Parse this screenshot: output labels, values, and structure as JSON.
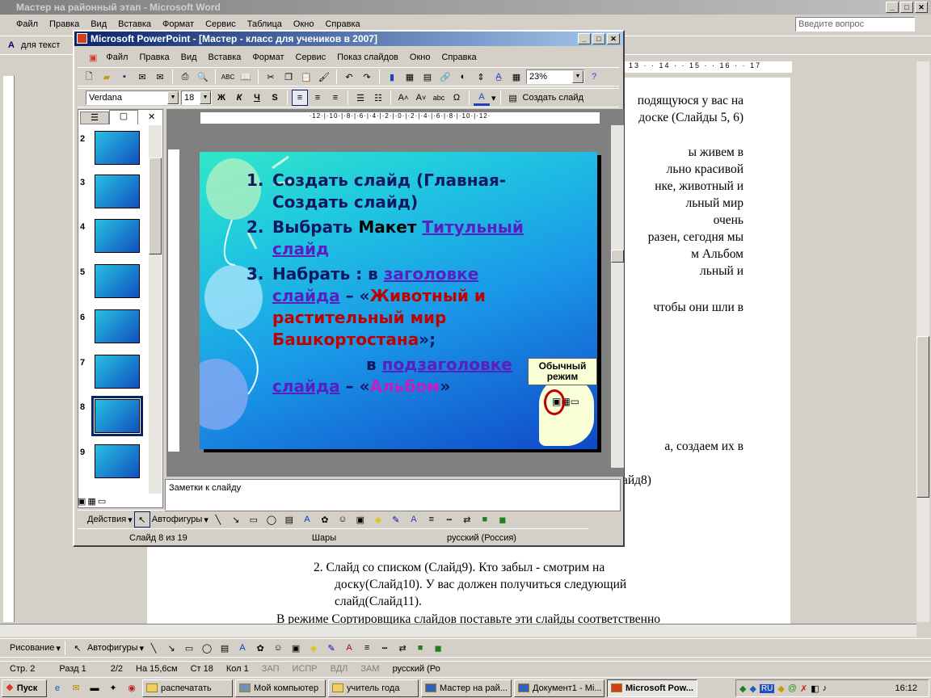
{
  "word": {
    "title": "Мастер на районный этап - Microsoft Word",
    "help_placeholder": "Введите вопрос",
    "style_box": "для текст",
    "ruler_nums": [
      "13",
      "14",
      "15",
      "16",
      "17"
    ],
    "lines": [
      "подящуюся у вас на",
      "доске (Слайды 5, 6)",
      "ы живем в",
      "льно красивой",
      "нке, животный и",
      "льный мир",
      "очень",
      "разен, сегодня мы",
      "м Альбом",
      "льный и",
      "чтобы они шли в",
      "а, создаем их в",
      "айд8)"
    ],
    "para2": [
      "2.  Слайд со списком (Слайд9). Кто забыл - смотрим на",
      "доску(Слайд10). У вас должен получиться следующий",
      "слайд(Слайд11)."
    ],
    "last_line": "В режиме Сортировщика слайдов поставьте эти слайды соответственно",
    "draw_label": "Рисование",
    "autoshapes": "Автофигуры",
    "status": {
      "page": "Стр. 2",
      "section": "Разд 1",
      "pages": "2/2",
      "at": "На 15,6см",
      "line": "Ст 18",
      "col": "Кол 1",
      "rec": "ЗАП",
      "trk": "ИСПР",
      "ext": "ВДЛ",
      "ovr": "ЗАМ",
      "lang": "русский (Ро"
    }
  },
  "ppt": {
    "title": "Microsoft PowerPoint - [Мастер - класс для учеников в 2007]",
    "menu": [
      "Файл",
      "Правка",
      "Вид",
      "Вставка",
      "Формат",
      "Сервис",
      "Показ слайдов",
      "Окно",
      "Справка"
    ],
    "zoom": "23%",
    "font": "Verdana",
    "size": "18",
    "fmt": [
      "Ж",
      "К",
      "Ч",
      "S"
    ],
    "new_slide": "Создать слайд",
    "ruler": "·12·|·10·|·8·|·6·|·4·|·2·|·0·|·2·|·4·|·6·|·8·|·10·|·12·",
    "thumb_nums": [
      "2",
      "3",
      "4",
      "5",
      "6",
      "7",
      "8",
      "9"
    ],
    "slide": {
      "i1a": "Создать слайд (Главная-",
      "i1b": "Создать слайд)",
      "i2a": "Выбрать ",
      "i2b": "Макет ",
      "i2c": "Титульный слайд",
      "i3a": "Набрать : в ",
      "i3b": "заголовке слайда",
      "i3c": " – «",
      "i3d": "Животный и растительный мир Башкортостана",
      "i3e": "»;",
      "p4a": "в ",
      "p4b": "подзаголовке",
      "p4c": "слайда",
      "p4d": " – «",
      "p4e": "Альбом",
      "p4f": "»",
      "callout": "Обычный режим"
    },
    "notes": "Заметки к слайду",
    "actions": "Действия",
    "autoshapes": "Автофигуры",
    "status": {
      "slide": "Слайд 8 из 19",
      "design": "Шары",
      "lang": "русский (Россия)"
    }
  },
  "taskbar": {
    "start": "Пуск",
    "items": [
      "распечатать",
      "Мой компьютер",
      "учитель года",
      "Мастер на рай...",
      "Документ1 - Mi...",
      "Microsoft Pow..."
    ],
    "time": "16:12",
    "lang": "RU"
  }
}
